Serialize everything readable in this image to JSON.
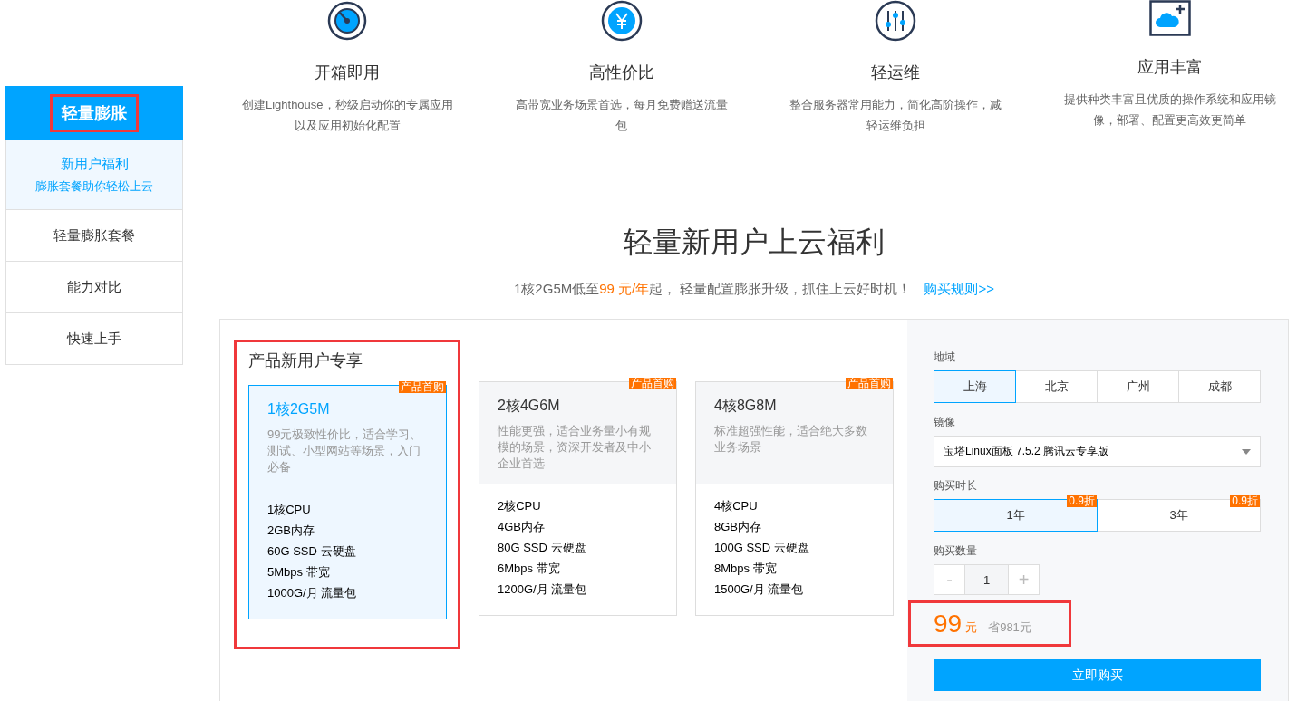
{
  "features": [
    {
      "kind": "gauge",
      "title": "开箱即用",
      "description": "创建Lighthouse，秒级启动你的专属应用以及应用初始化配置"
    },
    {
      "kind": "yen",
      "title": "高性价比",
      "description": "高带宽业务场景首选，每月免费赠送流量包"
    },
    {
      "kind": "sliders",
      "title": "轻运维",
      "description": "整合服务器常用能力，简化高阶操作，减轻运维负担"
    },
    {
      "kind": "cloud-plus",
      "title": "应用丰富",
      "description": "提供种类丰富且优质的操作系统和应用镜像，部署、配置更高效更简单"
    }
  ],
  "sidebar": {
    "header": {
      "label": "轻量膨胀",
      "highlighted": true
    },
    "items": [
      {
        "label": "新用户福利",
        "sublabel": "膨胀套餐助你轻松上云",
        "selected": true
      },
      {
        "label": "轻量膨胀套餐",
        "selected": false
      },
      {
        "label": "能力对比",
        "selected": false
      },
      {
        "label": "快速上手",
        "selected": false
      }
    ]
  },
  "promo": {
    "title": "轻量新用户上云福利",
    "subtitle": [
      {
        "kind": "plain",
        "text": "1核2G5M低至"
      },
      {
        "kind": "price",
        "text": "99 元/年"
      },
      {
        "kind": "plain",
        "text": "起， 轻量配置膨胀升级，抓住上云好时机！"
      }
    ],
    "link": "购买规则>>"
  },
  "plans": {
    "title": "产品新用户专享",
    "highlighted": true,
    "items": [
      {
        "name": "1核2G5M",
        "badge": "产品首购",
        "description": "99元极致性价比，适合学习、测试、小型网站等场景，入门必备",
        "specs": [
          "1核CPU",
          "2GB内存",
          "60G SSD 云硬盘",
          "5Mbps 带宽",
          "1000G/月 流量包"
        ],
        "selected": true
      },
      {
        "name": "2核4G6M",
        "badge": "产品首购",
        "description": "性能更强，适合业务量小有规模的场景，资深开发者及中小企业首选",
        "specs": [
          "2核CPU",
          "4GB内存",
          "80G SSD 云硬盘",
          "6Mbps 带宽",
          "1200G/月 流量包"
        ],
        "selected": false
      },
      {
        "name": "4核8G8M",
        "badge": "产品首购",
        "description": "标准超强性能，适合绝大多数业务场景",
        "specs": [
          "4核CPU",
          "8GB内存",
          "100G SSD 云硬盘",
          "8Mbps 带宽",
          "1500G/月 流量包"
        ],
        "selected": false
      }
    ]
  },
  "order": {
    "region": {
      "label": "地域",
      "options": [
        {
          "label": "上海",
          "selected": true
        },
        {
          "label": "北京",
          "selected": false
        },
        {
          "label": "广州",
          "selected": false
        },
        {
          "label": "成都",
          "selected": false
        }
      ]
    },
    "image": {
      "label": "镜像",
      "value": "宝塔Linux面板 7.5.2 腾讯云专享版"
    },
    "duration": {
      "label": "购买时长",
      "options": [
        {
          "label": "1年",
          "badge": "0.9折",
          "selected": true
        },
        {
          "label": "3年",
          "badge": "0.9折",
          "selected": false
        }
      ]
    },
    "quantity": {
      "label": "购买数量",
      "decrement": "-",
      "value": "1",
      "increment": "+"
    },
    "price": {
      "amount": "99",
      "unit": "元",
      "saving": "省981元",
      "highlighted": true
    },
    "buy_button": "立即购买"
  }
}
